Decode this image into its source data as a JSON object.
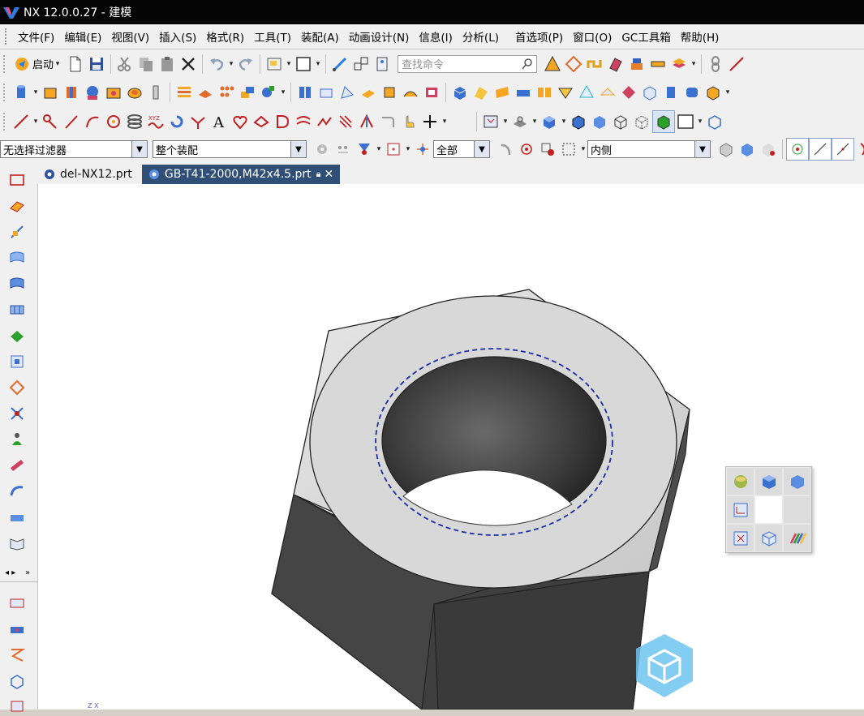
{
  "window": {
    "title": "NX 12.0.0.27 - 建模"
  },
  "menu": {
    "items": [
      "文件(F)",
      "编辑(E)",
      "视图(V)",
      "插入(S)",
      "格式(R)",
      "工具(T)",
      "装配(A)",
      "动画设计(N)",
      "信息(I)",
      "分析(L)",
      "首选项(P)",
      "窗口(O)",
      "GC工具箱",
      "帮助(H)"
    ]
  },
  "toolbar": {
    "start_label": "启动",
    "search_placeholder": "查找命令"
  },
  "selection_bar": {
    "filter_value": "无选择过滤器",
    "scope_value": "整个装配",
    "all_value": "全部",
    "inside_value": "内侧"
  },
  "tabs": [
    {
      "label": "del-NX12.prt",
      "active": false
    },
    {
      "label": "GB-T41-2000,M42x4.5.prt",
      "active": true,
      "locked": true
    }
  ],
  "triad": {
    "labels": "Z X"
  },
  "colors": {
    "titlebar": "#050505",
    "active_tab": "#2f4f76",
    "toolbar_bg": "#f0f0f0",
    "model_dark": "#3c3c3c",
    "model_light": "#d8d8d8",
    "hole_edge": "#1a2fa8"
  }
}
